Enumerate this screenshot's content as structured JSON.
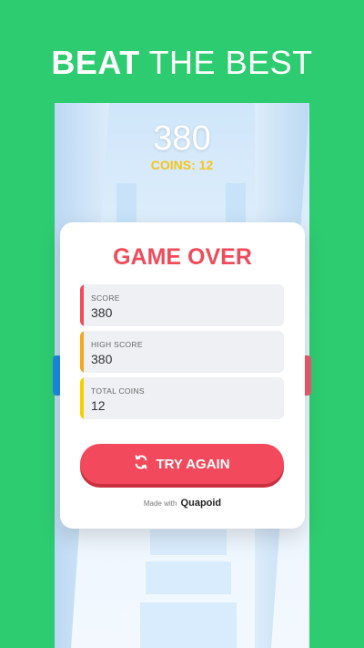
{
  "headline": {
    "bold": "BEAT",
    "rest": " THE BEST"
  },
  "hud": {
    "score": "380",
    "coins": "COINS: 12"
  },
  "game_over": {
    "title": "GAME OVER",
    "stats": [
      {
        "label": "SCORE",
        "value": "380",
        "color": "#ef4b5a"
      },
      {
        "label": "HIGH SCORE",
        "value": "380",
        "color": "#f5a623"
      },
      {
        "label": "TOTAL COINS",
        "value": "12",
        "color": "#f5d000"
      }
    ],
    "try_again_label": "TRY AGAIN",
    "made_with_label": "Made with",
    "brand": "Quapoid"
  },
  "colors": {
    "background": "#2ecc71",
    "accent": "#f24a5c"
  },
  "icons": {
    "try_again": "refresh-icon"
  }
}
